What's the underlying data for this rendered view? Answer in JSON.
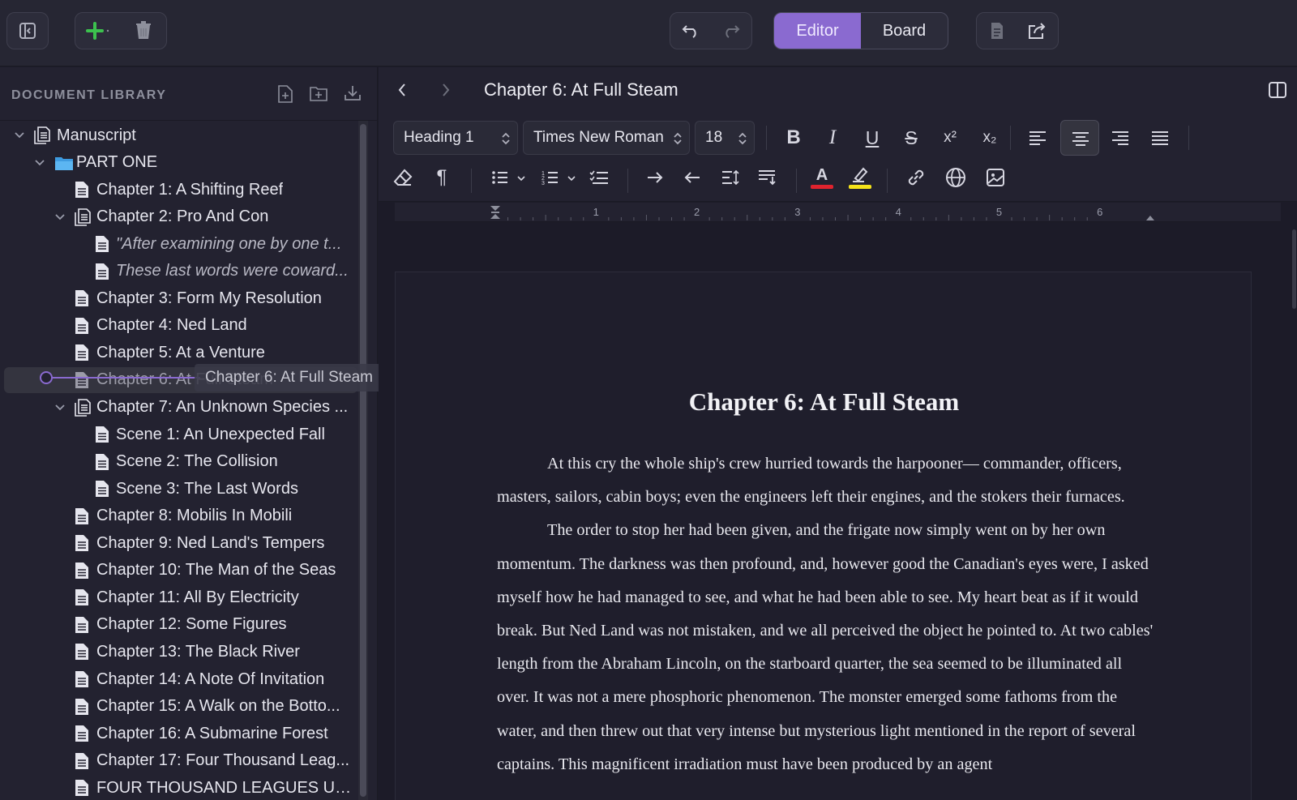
{
  "toolbar": {
    "sidebar_toggle": "sidebar-toggle-icon",
    "add": "plus-icon",
    "trash": "trash-icon",
    "undo": "undo-icon",
    "redo": "redo-icon",
    "view_tabs": [
      {
        "label": "Editor",
        "active": true
      },
      {
        "label": "Board",
        "active": false
      }
    ],
    "doc_icon": "document-icon",
    "share_icon": "share-icon",
    "accent": "#8a6ad0"
  },
  "sidebar": {
    "title": "DOCUMENT LIBRARY",
    "drag_ghost_label": "Chapter 6: At Full Steam",
    "items": [
      {
        "label": "Manuscript",
        "level": 0,
        "chevron": true,
        "icon": "manuscript-icon"
      },
      {
        "label": "PART ONE",
        "level": 1,
        "chevron": true,
        "icon": "folder-icon"
      },
      {
        "label": "Chapter 1: A Shifting Reef",
        "level": 2,
        "chevron": false,
        "icon": "document-icon"
      },
      {
        "label": "Chapter 2: Pro And Con",
        "level": 2,
        "chevron": true,
        "icon": "document-stack-icon"
      },
      {
        "label": "\"After examining one by one t...",
        "level": 3,
        "chevron": false,
        "icon": "document-icon",
        "italic": true
      },
      {
        "label": "These last words were coward...",
        "level": 3,
        "chevron": false,
        "icon": "document-icon",
        "italic": true
      },
      {
        "label": "Chapter 3: Form My Resolution",
        "level": 2,
        "chevron": false,
        "icon": "document-icon"
      },
      {
        "label": "Chapter 4: Ned Land",
        "level": 2,
        "chevron": false,
        "icon": "document-icon"
      },
      {
        "label": "Chapter 5: At a Venture",
        "level": 2,
        "chevron": false,
        "icon": "document-icon"
      },
      {
        "label": "Chapter 6: At Full Steam",
        "level": 2,
        "chevron": false,
        "icon": "document-icon",
        "selected": true
      },
      {
        "label": "Chapter 7: An Unknown Species ...",
        "level": 2,
        "chevron": true,
        "icon": "document-stack-icon"
      },
      {
        "label": "Scene 1: An Unexpected Fall",
        "level": 3,
        "chevron": false,
        "icon": "document-icon"
      },
      {
        "label": "Scene 2: The Collision",
        "level": 3,
        "chevron": false,
        "icon": "document-icon"
      },
      {
        "label": "Scene 3: The Last Words",
        "level": 3,
        "chevron": false,
        "icon": "document-icon"
      },
      {
        "label": "Chapter 8: Mobilis In Mobili",
        "level": 2,
        "chevron": false,
        "icon": "document-icon"
      },
      {
        "label": "Chapter 9: Ned Land's Tempers",
        "level": 2,
        "chevron": false,
        "icon": "document-icon"
      },
      {
        "label": "Chapter 10: The Man of the Seas",
        "level": 2,
        "chevron": false,
        "icon": "document-icon"
      },
      {
        "label": "Chapter 11: All By Electricity",
        "level": 2,
        "chevron": false,
        "icon": "document-icon"
      },
      {
        "label": "Chapter 12: Some Figures",
        "level": 2,
        "chevron": false,
        "icon": "document-icon"
      },
      {
        "label": "Chapter 13: The Black River",
        "level": 2,
        "chevron": false,
        "icon": "document-icon"
      },
      {
        "label": "Chapter 14: A Note Of Invitation",
        "level": 2,
        "chevron": false,
        "icon": "document-icon"
      },
      {
        "label": "Chapter 15: A Walk on the Botto...",
        "level": 2,
        "chevron": false,
        "icon": "document-icon"
      },
      {
        "label": "Chapter 16: A Submarine Forest",
        "level": 2,
        "chevron": false,
        "icon": "document-icon"
      },
      {
        "label": "Chapter 17: Four Thousand Leag...",
        "level": 2,
        "chevron": false,
        "icon": "document-icon"
      },
      {
        "label": "FOUR THOUSAND LEAGUES UN...",
        "level": 2,
        "chevron": false,
        "icon": "document-icon"
      }
    ]
  },
  "editor": {
    "doc_title": "Chapter 6: At Full Steam",
    "style_select": "Heading 1",
    "font_select": "Times New Roman",
    "size_select": "18",
    "text_color": "#e0232e",
    "highlight_color": "#f5e31a",
    "ruler_numbers": [
      "1",
      "2",
      "3",
      "4",
      "5",
      "6"
    ],
    "page_heading": "Chapter 6: At Full Steam",
    "paragraphs": [
      "At this cry the whole ship's crew hurried towards the harpooner— commander, officers, masters, sailors, cabin boys; even the engineers left their engines, and the stokers their furnaces.",
      "The order to stop her had been given, and the frigate now simply went on by her own momentum. The darkness was then profound, and, however good the Canadian's eyes were, I asked myself how he had managed to see, and what he had been able to see. My heart beat as if it would break. But Ned Land was not mistaken, and we all perceived the object he pointed to. At two cables' length from the Abraham Lincoln, on the starboard quarter, the sea seemed to be illuminated all over. It was not a mere phosphoric phenomenon. The monster emerged some fathoms from the water, and then threw out that very intense but mysterious light mentioned in the report of several captains. This magnificent irradiation must have been produced by an agent"
    ]
  }
}
